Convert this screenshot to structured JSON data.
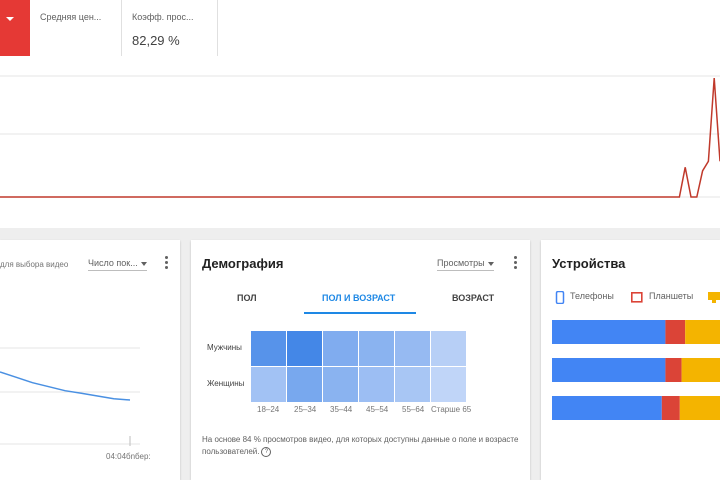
{
  "metrics": {
    "avg_price_label": "Средняя цен...",
    "ctr_label": "Коэфф. прос...",
    "ctr_value": "82,29 %"
  },
  "colors": {
    "metric_red": "#e53935",
    "main_line": "#c0392b",
    "accent_blue": "#1e88e5",
    "phones": "#4285f4",
    "tablets": "#db4437",
    "computers": "#f4b400"
  },
  "main_chart_data": {
    "type": "line",
    "points": [
      0,
      0,
      0,
      0,
      0,
      0,
      0,
      0,
      0,
      0,
      0,
      0,
      0,
      0,
      0,
      0,
      0,
      0,
      0,
      0,
      0,
      0,
      0,
      0,
      0,
      0,
      0,
      0,
      0,
      0,
      0,
      0,
      0,
      0,
      0,
      0,
      0,
      0,
      0,
      0,
      0,
      0,
      0,
      0,
      0,
      0,
      0,
      0,
      0,
      0,
      0,
      0,
      0,
      0,
      0,
      0,
      0,
      0,
      0,
      0,
      0,
      0,
      0,
      0,
      0,
      0,
      0,
      0,
      0,
      0,
      0,
      0,
      0,
      0,
      0,
      0,
      0,
      0,
      0,
      0,
      0,
      0,
      0,
      0,
      0,
      0,
      0,
      0,
      0,
      0,
      0,
      0,
      0,
      0,
      0,
      0,
      0,
      0,
      0,
      0,
      0,
      0,
      0,
      0,
      0,
      0,
      0,
      0,
      0,
      0,
      0,
      0,
      0,
      0,
      0,
      0,
      0,
      0,
      0.25,
      0,
      0,
      0.22,
      0.3,
      1.0,
      0.3
    ]
  },
  "left_card": {
    "caption": "для выбора видео",
    "select_value": "Число пок...",
    "x_end_label": "04:04бnбер:",
    "chart_data": {
      "type": "line",
      "values": [
        100,
        96,
        92,
        89,
        86,
        84,
        82,
        80,
        79
      ]
    }
  },
  "demography": {
    "title": "Демография",
    "select_value": "Просмотры",
    "tabs": [
      "ПОЛ",
      "ПОЛ И ВОЗРАСТ",
      "ВОЗРАСТ"
    ],
    "active_tab": 1,
    "rows": [
      "Мужчины",
      "Женщины"
    ],
    "columns": [
      "18–24",
      "25–34",
      "35–44",
      "45–54",
      "55–64",
      "Старше 65"
    ],
    "heatmap_data": {
      "type": "heatmap",
      "values": [
        [
          0.82,
          0.95,
          0.55,
          0.48,
          0.4,
          0.18
        ],
        [
          0.32,
          0.6,
          0.48,
          0.36,
          0.28,
          0.12
        ]
      ]
    },
    "note": "На основе 84 % просмотров видео, для которых доступны данные о поле и возрасте пользователей.",
    "help_icon": "?"
  },
  "devices": {
    "title": "Устройства",
    "legend": [
      "Телефоны",
      "Планшеты"
    ],
    "legend_icons": [
      "phone-icon",
      "tablet-icon",
      "computer-icon"
    ],
    "chart_data": {
      "type": "bar",
      "stacked": true,
      "series": [
        {
          "values": [
            63,
            63,
            61
          ]
        },
        {
          "values": [
            11,
            9,
            10
          ]
        },
        {
          "values": [
            26,
            28,
            29
          ]
        }
      ]
    }
  }
}
